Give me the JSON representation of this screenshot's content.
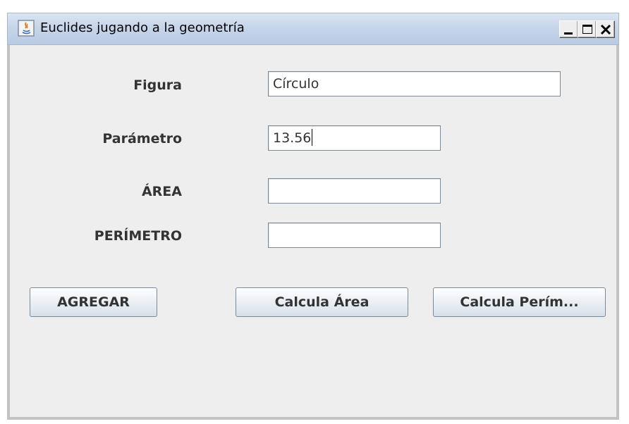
{
  "window": {
    "title": "Euclides jugando a la geometría",
    "controls": [
      "minimize-icon",
      "maximize-icon",
      "close-icon"
    ]
  },
  "form": {
    "figura_label": "Figura",
    "figura_value": "Círculo",
    "parametro_label": "Parámetro",
    "parametro_value": "13.56",
    "area_label": "ÁREA",
    "area_value": "",
    "perimetro_label": "PERÍMETRO",
    "perimetro_value": ""
  },
  "buttons": {
    "agregar": "AGREGAR",
    "calcula_area": "Calcula Área",
    "calcula_perimetro": "Calcula Perím..."
  }
}
